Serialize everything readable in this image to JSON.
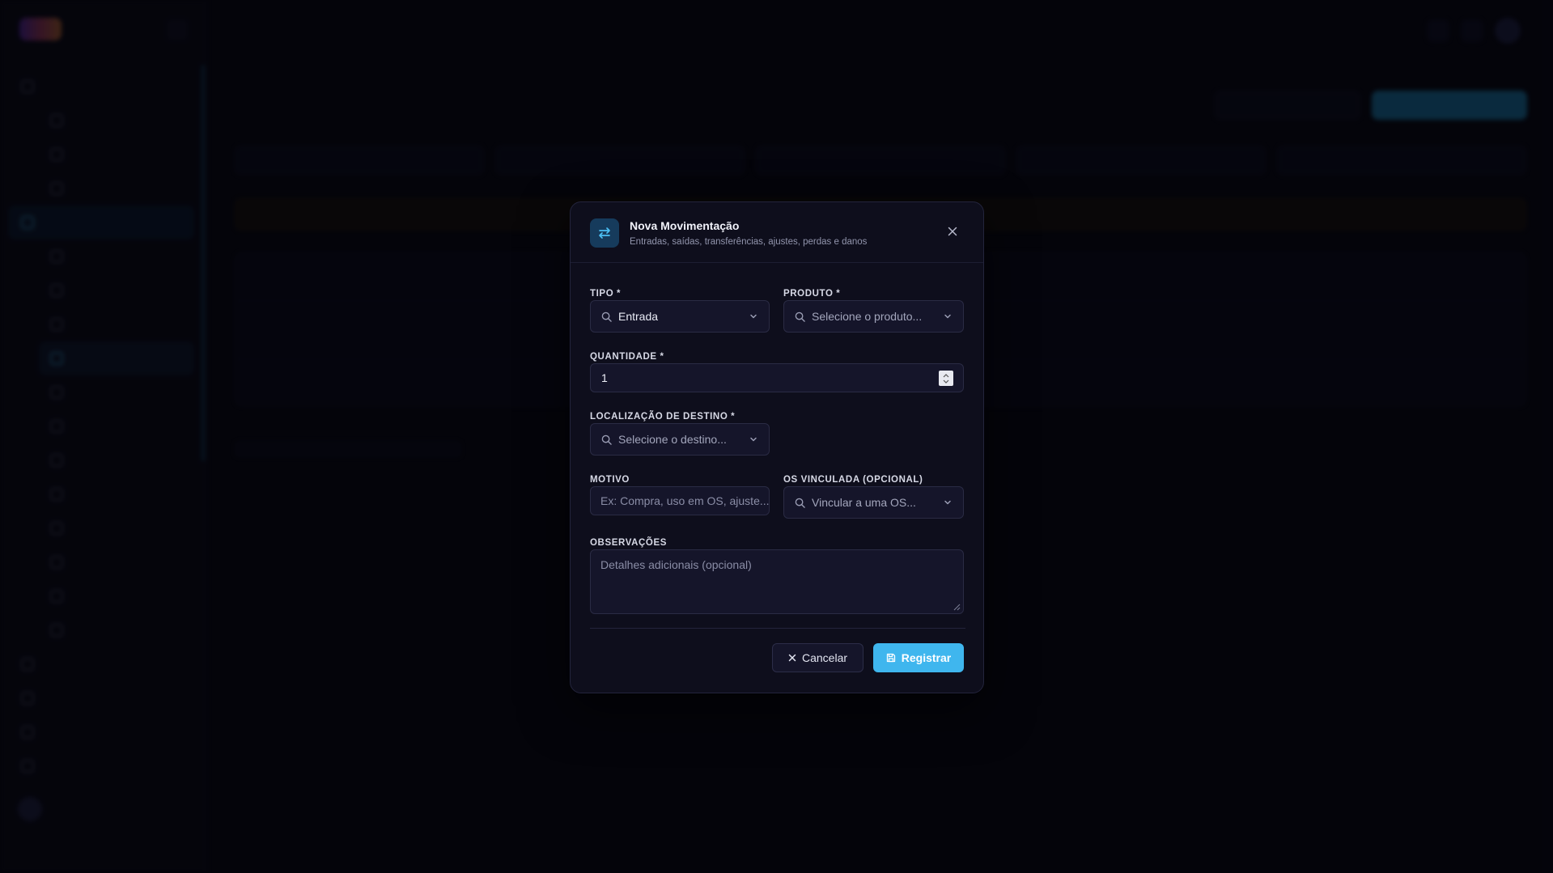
{
  "modal": {
    "title": "Nova Movimentação",
    "subtitle": "Entradas, saídas, transferências, ajustes, perdas e danos",
    "tipo": {
      "label": "TIPO *",
      "value": "Entrada"
    },
    "produto": {
      "label": "PRODUTO *",
      "placeholder": "Selecione o produto..."
    },
    "quantidade": {
      "label": "QUANTIDADE *",
      "value": "1"
    },
    "destino": {
      "label": "LOCALIZAÇÃO DE DESTINO *",
      "placeholder": "Selecione o destino..."
    },
    "motivo": {
      "label": "MOTIVO",
      "placeholder": "Ex: Compra, uso em OS, ajuste..."
    },
    "os": {
      "label": "OS VINCULADA (OPCIONAL)",
      "placeholder": "Vincular a uma OS..."
    },
    "observacoes": {
      "label": "OBSERVAÇÕES",
      "placeholder": "Detalhes adicionais (opcional)"
    },
    "cancel_label": "Cancelar",
    "submit_label": "Registrar"
  },
  "colors": {
    "accent": "#3fb6ee",
    "modal_bg": "#0e0e1c",
    "field_bg": "#15152a"
  },
  "icons": {
    "header": "arrows-exchange-icon",
    "close": "close-icon",
    "search": "search-icon",
    "chevron": "chevron-down-icon",
    "cancel": "x-icon",
    "submit": "save-icon"
  }
}
